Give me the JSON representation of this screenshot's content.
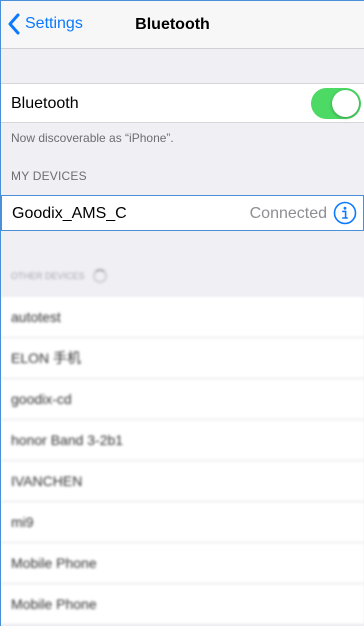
{
  "navbar": {
    "back_label": "Settings",
    "title": "Bluetooth"
  },
  "bluetooth": {
    "label": "Bluetooth",
    "enabled": true,
    "accent": "#4cd964"
  },
  "discoverable_note": "Now discoverable as “iPhone”.",
  "my_devices": {
    "header": "MY DEVICES",
    "items": [
      {
        "name": "Goodix_AMS_C",
        "status": "Connected"
      }
    ]
  },
  "other_devices": {
    "header": "OTHER DEVICES",
    "items": [
      {
        "name": "autotest"
      },
      {
        "name": "ELON 手机"
      },
      {
        "name": "goodix-cd"
      },
      {
        "name": "honor Band 3-2b1"
      },
      {
        "name": "IVANCHEN"
      },
      {
        "name": "mi9"
      },
      {
        "name": "Mobile Phone"
      },
      {
        "name": "Mobile Phone"
      }
    ]
  },
  "colors": {
    "tint": "#0a7aff",
    "toggle_on": "#4cd964"
  },
  "icons": {
    "back": "chevron-left-icon",
    "info": "info-circle-icon",
    "spinner": "spinner-icon"
  }
}
